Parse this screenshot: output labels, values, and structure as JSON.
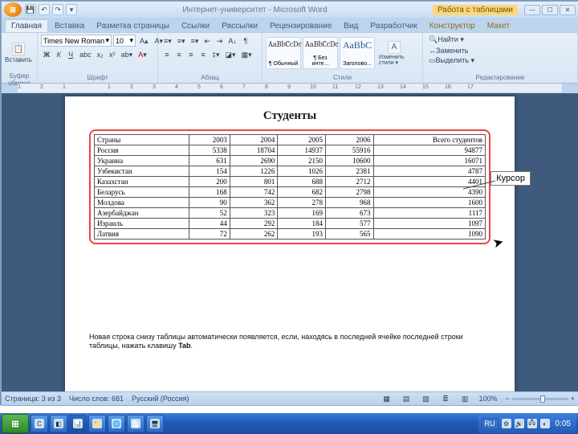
{
  "title": {
    "app": "Интернет-университет - Microsoft Word",
    "context_tools": "Работа с таблицами"
  },
  "tabs": {
    "home": "Главная",
    "insert": "Вставка",
    "layout": "Разметка страницы",
    "refs": "Ссылки",
    "mail": "Рассылки",
    "review": "Рецензирование",
    "view": "Вид",
    "dev": "Разработчик",
    "design": "Конструктор",
    "tlayout": "Макет"
  },
  "groups": {
    "clipboard": "Буфер обмена",
    "font": "Шрифт",
    "paragraph": "Абзац",
    "styles": "Стили",
    "editing": "Редактирование"
  },
  "clipboard": {
    "paste": "Вставить"
  },
  "font": {
    "family": "Times New Roman",
    "size": "10",
    "drop": "▾"
  },
  "styles": {
    "s1_sample": "AaBbCcDc",
    "s1_name": "¶ Обычный",
    "s2_sample": "AaBbCcDc",
    "s2_name": "¶ Без инте...",
    "s3_sample": "АаВbС",
    "s3_name": "Заголово...",
    "change": "Изменить стили ▾"
  },
  "editing": {
    "find": "Найти ▾",
    "replace": "Заменить",
    "select": "Выделить ▾"
  },
  "ruler_marks": [
    "1",
    "2",
    "1",
    "",
    "1",
    "2",
    "3",
    "4",
    "5",
    "6",
    "7",
    "8",
    "9",
    "10",
    "11",
    "12",
    "13",
    "14",
    "15",
    "16",
    "17"
  ],
  "doc": {
    "heading": "Студенты",
    "headers": [
      "Страны",
      "2003",
      "2004",
      "2005",
      "2006",
      "Всего студентов"
    ],
    "rows": [
      [
        "Россия",
        "5338",
        "18704",
        "14937",
        "55916",
        "94877"
      ],
      [
        "Украина",
        "631",
        "2690",
        "2150",
        "10600",
        "16071"
      ],
      [
        "Узбекистан",
        "154",
        "1226",
        "1026",
        "2381",
        "4787"
      ],
      [
        "Казахстан",
        "200",
        "801",
        "688",
        "2712",
        "4401"
      ],
      [
        "Беларусь",
        "168",
        "742",
        "682",
        "2798",
        "4390"
      ],
      [
        "Молдова",
        "90",
        "362",
        "278",
        "968",
        "1600"
      ],
      [
        "Азербайджан",
        "52",
        "323",
        "169",
        "673",
        "1117"
      ],
      [
        "Израиль",
        "44",
        "292",
        "184",
        "577",
        "1097"
      ],
      [
        "Латвия",
        "72",
        "262",
        "193",
        "565",
        "1090"
      ]
    ],
    "callout": "Курсор",
    "caption_p1": "Новая строка снизу таблицы автоматически появляется, если, находясь в последней ячейке последней строки таблицы, нажать клавишу ",
    "caption_b": "Tab",
    "caption_p2": "."
  },
  "status": {
    "page": "Страница: 3 из 3",
    "words": "Число слов: 681",
    "lang": "Русский (Россия)",
    "zoom": "100%"
  },
  "taskbar": {
    "lang": "RU",
    "time": "0:05"
  }
}
